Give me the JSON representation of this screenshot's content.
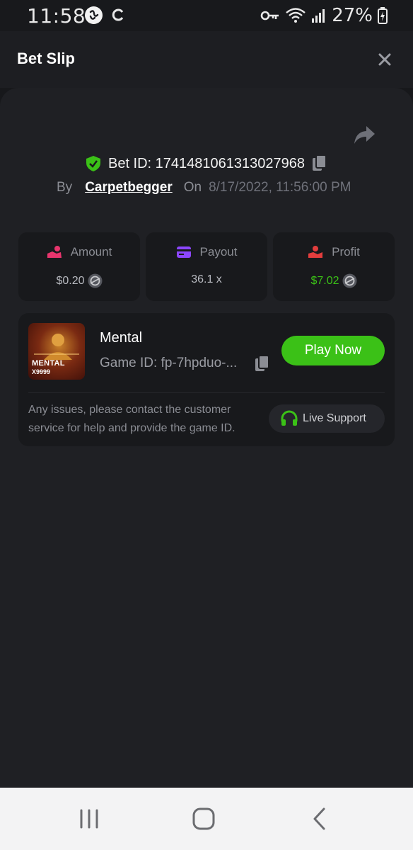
{
  "status_bar": {
    "time": "11:58",
    "battery": "27%",
    "icons": [
      "link-app-icon",
      "sync-icon",
      "vpn-key-icon",
      "wifi-icon",
      "signal-icon",
      "battery-charging-icon"
    ]
  },
  "header": {
    "title": "Bet Slip",
    "close_icon": "close-icon"
  },
  "bet": {
    "id_label": "Bet ID: 1741481061313027968",
    "by_label": "By",
    "username": "Carpetbegger",
    "on_label": "On",
    "date": "8/17/2022, 11:56:00 PM"
  },
  "stats": [
    {
      "label": "Amount",
      "value": "$0.20",
      "icon": "hand-coins-icon",
      "color": "#e8356d"
    },
    {
      "label": "Payout",
      "value": "36.1 x",
      "icon": "card-icon",
      "color": "#8c46ff"
    },
    {
      "label": "Profit",
      "value": "$7.02",
      "icon": "hand-money-icon",
      "color": "#e33d3d",
      "value_color": "#3bc117"
    }
  ],
  "game": {
    "name": "Mental",
    "id_label": "Game ID: fp-7hpduo-...",
    "thumb_title": "MENTAL",
    "thumb_sub": "X9999",
    "play_label": "Play Now",
    "help_text": "Any issues, please contact the customer service for help and provide the game ID.",
    "support_label": "Live Support"
  },
  "colors": {
    "accent_green": "#3bc117",
    "background": "#17181b",
    "panel": "#1f2024"
  },
  "nav": [
    "recents-icon",
    "home-icon",
    "back-icon"
  ]
}
